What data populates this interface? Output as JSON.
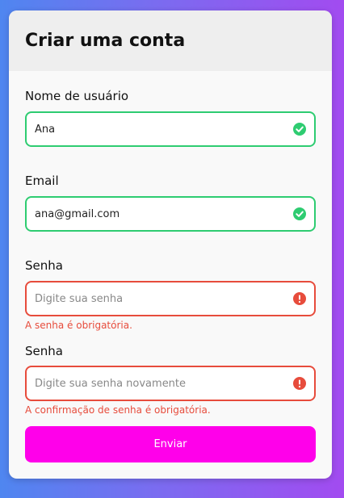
{
  "form": {
    "title": "Criar uma conta",
    "username": {
      "label": "Nome de usuário",
      "value": "Ana",
      "status": "valid"
    },
    "email": {
      "label": "Email",
      "value": "ana@gmail.com",
      "status": "valid"
    },
    "password": {
      "label": "Senha",
      "placeholder": "Digite sua senha",
      "status": "error",
      "error": "A senha é obrigatória."
    },
    "password_confirm": {
      "label": "Senha",
      "placeholder": "Digite sua senha novamente",
      "status": "error",
      "error": "A confirmação de senha é obrigatória."
    },
    "submit_label": "Enviar"
  },
  "colors": {
    "valid": "#2ecc71",
    "error": "#e74c3c",
    "button": "#ff00ea"
  },
  "icons": {
    "valid": "check-circle-icon",
    "error": "exclamation-circle-icon"
  }
}
